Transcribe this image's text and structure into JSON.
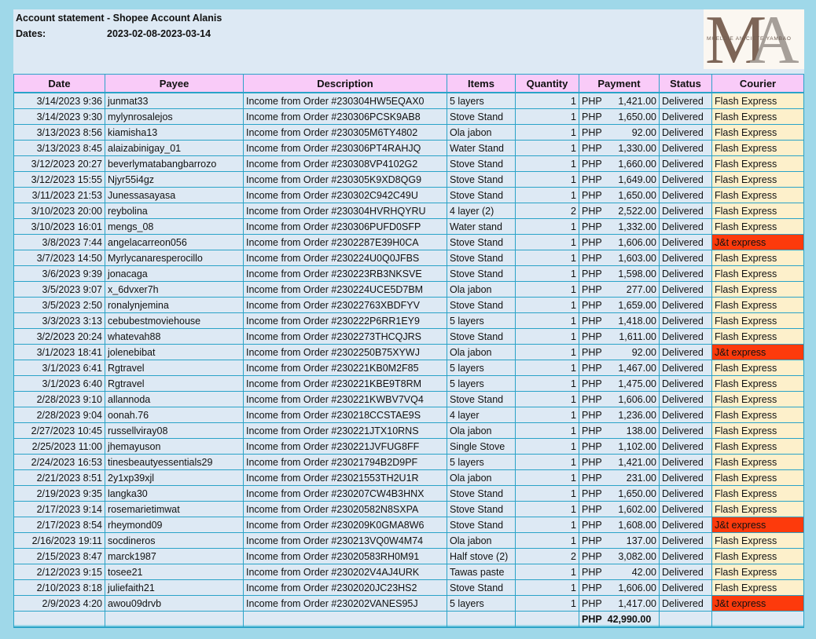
{
  "header": {
    "title": "Account statement - Shopee Account Alanis",
    "dates_label": "Dates:",
    "dates_value": "2023-02-08-2023-03-14",
    "logo_text": "MHELDIE ANICIETE YAMBAO",
    "logo_letters": "MA"
  },
  "columns": [
    "Date",
    "Payee",
    "Description",
    "Items",
    "Quantity",
    "Payment",
    "Status",
    "Courier"
  ],
  "currency": "PHP",
  "colors": {
    "header_bg": "#f9cbf8",
    "courier_bg": "#fdf0cb",
    "jt_bg": "#fd3a0c",
    "border": "#2aa3c8"
  },
  "rows": [
    [
      "3/14/2023 9:36",
      "junmat33",
      "Income from Order #230304HW5EQAX0",
      "5 layers",
      "1",
      "1,421.00",
      "Delivered",
      "Flash Express"
    ],
    [
      "3/14/2023 9:30",
      "mylynrosalejos",
      "Income from Order #230306PCSK9AB8",
      "Stove Stand",
      "1",
      "1,650.00",
      "Delivered",
      "Flash Express"
    ],
    [
      "3/13/2023 8:56",
      "kiamisha13",
      "Income from Order #230305M6TY4802",
      "Ola jabon",
      "1",
      "92.00",
      "Delivered",
      "Flash Express"
    ],
    [
      "3/13/2023 8:45",
      "alaizabinigay_01",
      "Income from Order #230306PT4RAHJQ",
      "Water Stand",
      "1",
      "1,330.00",
      "Delivered",
      "Flash Express"
    ],
    [
      "3/12/2023 20:27",
      "beverlymatabangbarrozo",
      "Income from Order #230308VP4102G2",
      "Stove Stand",
      "1",
      "1,660.00",
      "Delivered",
      "Flash Express"
    ],
    [
      "3/12/2023 15:55",
      "Njyr55i4gz",
      "Income from Order #230305K9XD8QG9",
      "Stove Stand",
      "1",
      "1,649.00",
      "Delivered",
      "Flash Express"
    ],
    [
      "3/11/2023 21:53",
      "Junessasayasa",
      "Income from Order #230302C942C49U",
      "Stove Stand",
      "1",
      "1,650.00",
      "Delivered",
      "Flash Express"
    ],
    [
      "3/10/2023 20:00",
      "reybolina",
      "Income from Order #230304HVRHQYRU",
      "4 layer (2)",
      "2",
      "2,522.00",
      "Delivered",
      "Flash Express"
    ],
    [
      "3/10/2023 16:01",
      "mengs_08",
      "Income from Order #230306PUFD0SFP",
      "Water stand",
      "1",
      "1,332.00",
      "Delivered",
      "Flash Express"
    ],
    [
      "3/8/2023 7:44",
      "angelacarreon056",
      "Income from Order #2302287E39H0CA",
      "Stove Stand",
      "1",
      "1,606.00",
      "Delivered",
      "J&t express"
    ],
    [
      "3/7/2023 14:50",
      "Myrlycanaresperocillo",
      "Income from Order #230224U0Q0JFBS",
      "Stove Stand",
      "1",
      "1,603.00",
      "Delivered",
      "Flash Express"
    ],
    [
      "3/6/2023 9:39",
      "jonacaga",
      "Income from Order #230223RB3NKSVE",
      "Stove Stand",
      "1",
      "1,598.00",
      "Delivered",
      "Flash Express"
    ],
    [
      "3/5/2023 9:07",
      "x_6dvxer7h",
      "Income from Order #230224UCE5D7BM",
      "Ola jabon",
      "1",
      "277.00",
      "Delivered",
      "Flash Express"
    ],
    [
      "3/5/2023 2:50",
      "ronalynjemina",
      "Income from Order #23022763XBDFYV",
      "Stove Stand",
      "1",
      "1,659.00",
      "Delivered",
      "Flash Express"
    ],
    [
      "3/3/2023 3:13",
      "cebubestmoviehouse",
      "Income from Order #230222P6RR1EY9",
      "5 layers",
      "1",
      "1,418.00",
      "Delivered",
      "Flash Express"
    ],
    [
      "3/2/2023 20:24",
      "whatevah88",
      "Income from Order #2302273THCQJRS",
      "Stove Stand",
      "1",
      "1,611.00",
      "Delivered",
      "Flash Express"
    ],
    [
      "3/1/2023 18:41",
      "jolenebibat",
      "Income from Order #2302250B75XYWJ",
      "Ola jabon",
      "1",
      "92.00",
      "Delivered",
      "J&t express"
    ],
    [
      "3/1/2023 6:41",
      "Rgtravel",
      "Income from Order #230221KB0M2F85",
      "5 layers",
      "1",
      "1,467.00",
      "Delivered",
      "Flash Express"
    ],
    [
      "3/1/2023 6:40",
      "Rgtravel",
      "Income from Order #230221KBE9T8RM",
      "5 layers",
      "1",
      "1,475.00",
      "Delivered",
      "Flash Express"
    ],
    [
      "2/28/2023 9:10",
      "allannoda",
      "Income from Order #230221KWBV7VQ4",
      "Stove Stand",
      "1",
      "1,606.00",
      "Delivered",
      "Flash Express"
    ],
    [
      "2/28/2023 9:04",
      "oonah.76",
      "Income from Order #230218CCSTAE9S",
      "4 layer",
      "1",
      "1,236.00",
      "Delivered",
      "Flash Express"
    ],
    [
      "2/27/2023 10:45",
      "russellviray08",
      "Income from Order #230221JTX10RNS",
      "Ola jabon",
      "1",
      "138.00",
      "Delivered",
      "Flash Express"
    ],
    [
      "2/25/2023 11:00",
      "jhemayuson",
      "Income from Order #230221JVFUG8FF",
      "Single Stove",
      "1",
      "1,102.00",
      "Delivered",
      "Flash Express"
    ],
    [
      "2/24/2023 16:53",
      "tinesbeautyessentials29",
      "Income from Order #23021794B2D9PF",
      "5 layers",
      "1",
      "1,421.00",
      "Delivered",
      "Flash Express"
    ],
    [
      "2/21/2023 8:51",
      "2y1xp39xjl",
      "Income from Order #23021553TH2U1R",
      "Ola jabon",
      "1",
      "231.00",
      "Delivered",
      "Flash Express"
    ],
    [
      "2/19/2023 9:35",
      "langka30",
      "Income from Order #230207CW4B3HNX",
      "Stove Stand",
      "1",
      "1,650.00",
      "Delivered",
      "Flash Express"
    ],
    [
      "2/17/2023 9:14",
      "rosemarietimwat",
      "Income from Order #23020582N8SXPA",
      "Stove Stand",
      "1",
      "1,602.00",
      "Delivered",
      "Flash Express"
    ],
    [
      "2/17/2023 8:54",
      "rheymond09",
      "Income from Order #230209K0GMA8W6",
      "Stove Stand",
      "1",
      "1,608.00",
      "Delivered",
      "J&t express"
    ],
    [
      "2/16/2023 19:11",
      "socdineros",
      "Income from Order #230213VQ0W4M74",
      "Ola jabon",
      "1",
      "137.00",
      "Delivered",
      "Flash Express"
    ],
    [
      "2/15/2023 8:47",
      "marck1987",
      "Income from Order #23020583RH0M91",
      "Half stove (2)",
      "2",
      "3,082.00",
      "Delivered",
      "Flash Express"
    ],
    [
      "2/12/2023 9:15",
      "tosee21",
      "Income from Order #230202V4AJ4URK",
      "Tawas paste",
      "1",
      "42.00",
      "Delivered",
      "Flash Express"
    ],
    [
      "2/10/2023 8:18",
      "juliefaith21",
      "Income from Order #2302020JC23HS2",
      "Stove Stand",
      "1",
      "1,606.00",
      "Delivered",
      "Flash Express"
    ],
    [
      "2/9/2023 4:20",
      "awou09drvb",
      "Income from Order #230202VANES95J",
      "5 layers",
      "1",
      "1,417.00",
      "Delivered",
      "J&t express"
    ]
  ],
  "total": {
    "currency": "PHP",
    "amount": "42,990.00"
  }
}
